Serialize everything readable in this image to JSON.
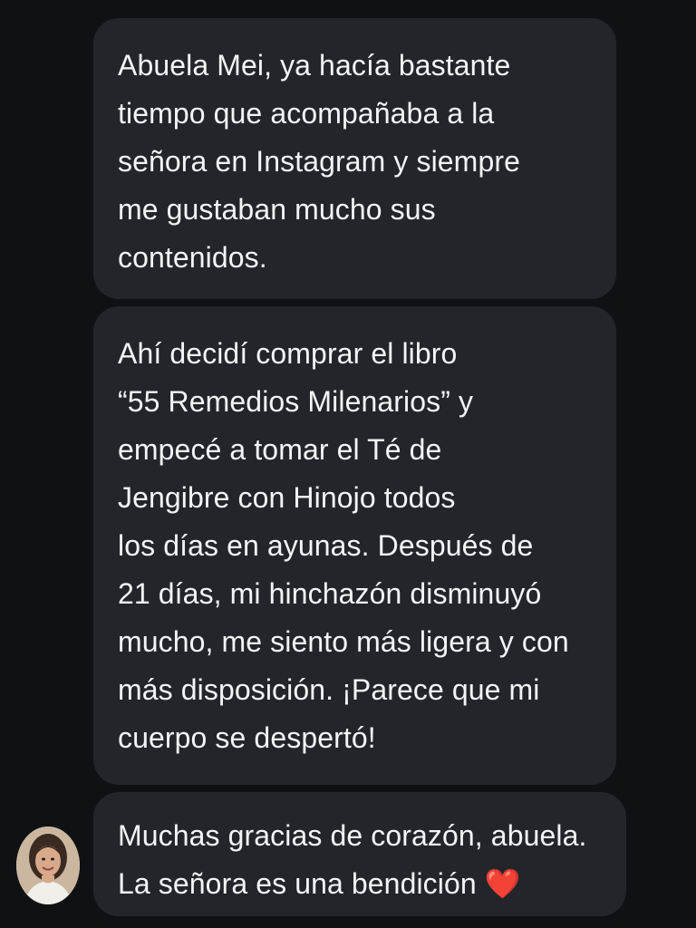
{
  "messages": [
    {
      "text": "Abuela Mei, ya hacía bastante\ntiempo que acompañaba a la\nseñora en Instagram y siempre\nme gustaban mucho sus\ncontenidos."
    },
    {
      "text": "Ahí decidí comprar el libro\n“55 Remedios Milenarios” y\nempecé a tomar el Té de\nJengibre con Hinojo todos\nlos días en ayunas. Después de\n21 días, mi hinchazón disminuyó\nmucho, me siento más ligera y con\nmás disposición. ¡Parece que mi\ncuerpo se despertó!"
    },
    {
      "text": "Muchas gracias de corazón, abuela.\nLa señora es una bendición ❤️"
    }
  ],
  "avatar": {
    "icon": "user-avatar-photo"
  },
  "colors": {
    "background": "#0f1115",
    "bubble": "#23252b",
    "text": "#f4f4f6"
  }
}
